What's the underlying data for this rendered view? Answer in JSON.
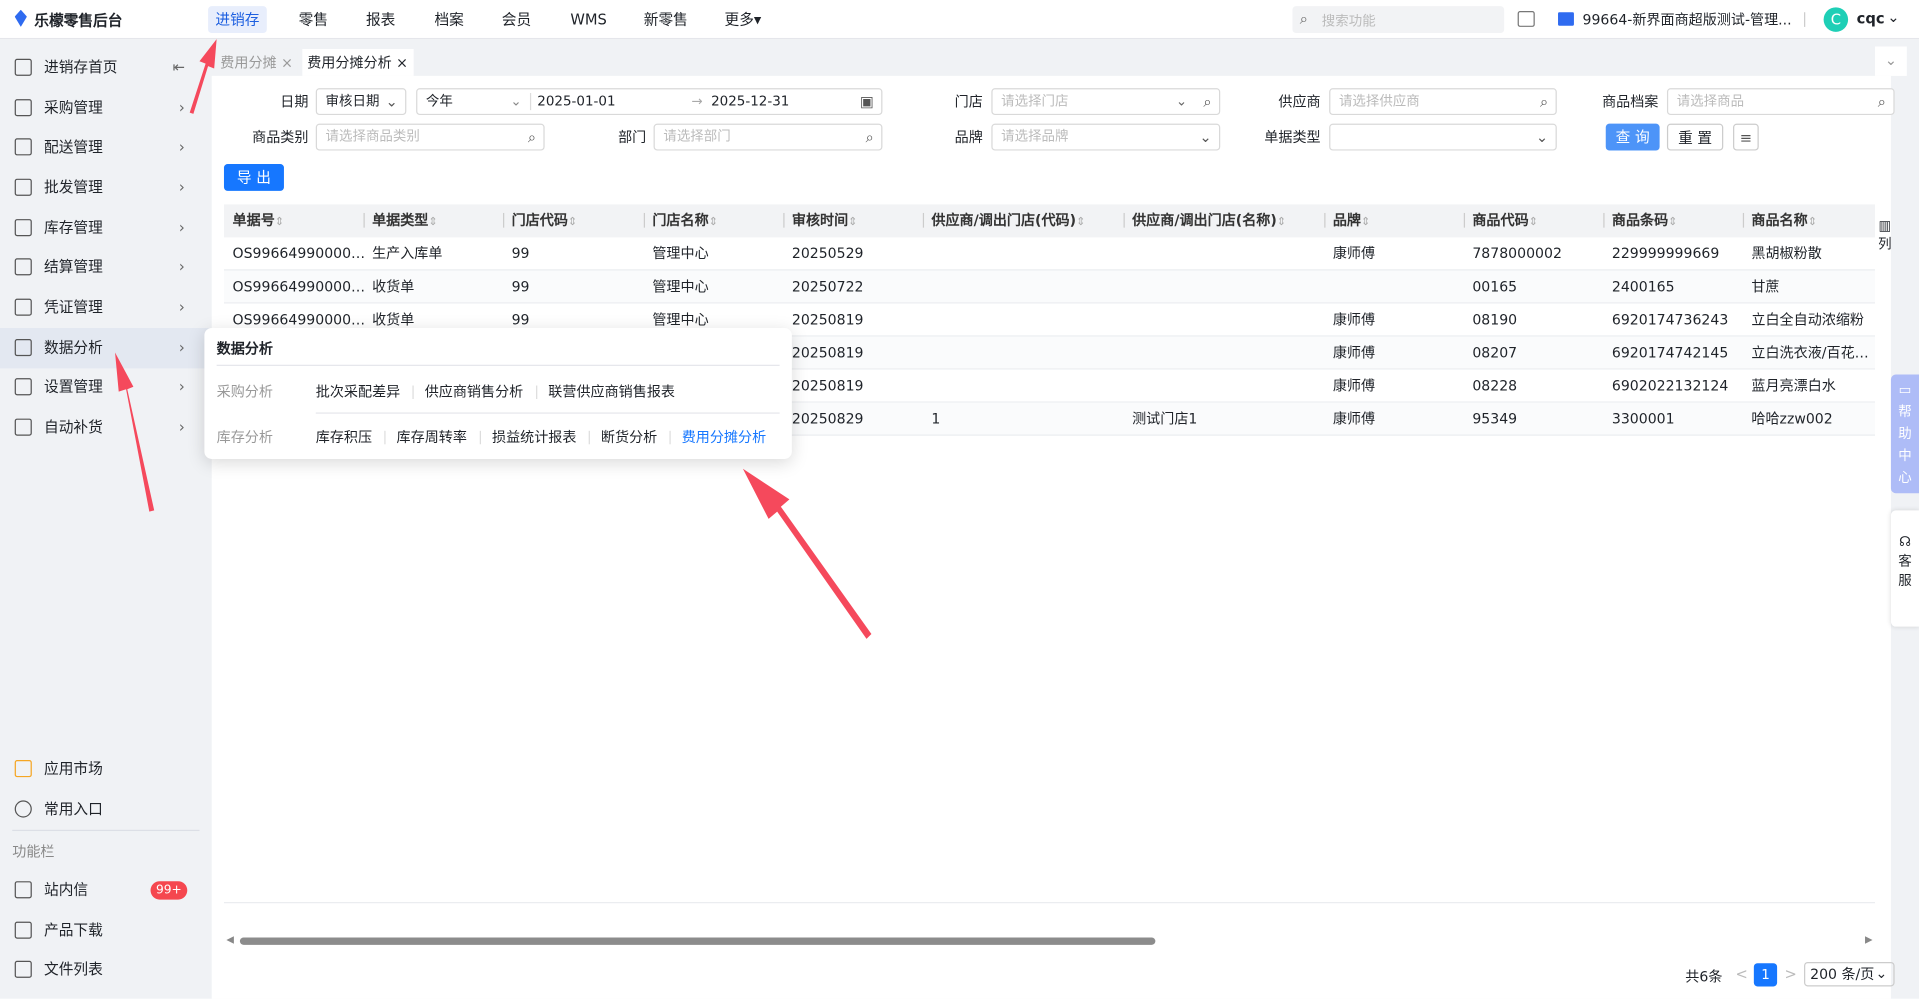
{
  "app": {
    "title": "乐檬零售后台"
  },
  "topnav": [
    {
      "label": "进销存",
      "active": true
    },
    {
      "label": "零售"
    },
    {
      "label": "报表"
    },
    {
      "label": "档案"
    },
    {
      "label": "会员"
    },
    {
      "label": "WMS"
    },
    {
      "label": "新零售"
    },
    {
      "label": "更多▾"
    }
  ],
  "header": {
    "search_placeholder": "搜索功能",
    "store": "99664-新界面商超版测试-管理...",
    "avatar_letter": "C",
    "user": "cqc"
  },
  "sidebar": {
    "items": [
      {
        "label": "进销存首页"
      },
      {
        "label": "采购管理"
      },
      {
        "label": "配送管理"
      },
      {
        "label": "批发管理"
      },
      {
        "label": "库存管理"
      },
      {
        "label": "结算管理"
      },
      {
        "label": "凭证管理"
      },
      {
        "label": "数据分析",
        "active": true
      },
      {
        "label": "设置管理"
      },
      {
        "label": "自动补货"
      }
    ],
    "bottom": [
      {
        "label": "应用市场"
      },
      {
        "label": "常用入口"
      }
    ],
    "section": "功能栏",
    "tools": [
      {
        "label": "站内信",
        "badge": "99+"
      },
      {
        "label": "产品下载"
      },
      {
        "label": "文件列表"
      }
    ]
  },
  "tabs": [
    {
      "label": "费用分摊",
      "close": "×"
    },
    {
      "label": "费用分摊分析",
      "close": "×",
      "active": true
    }
  ],
  "filters": {
    "date_label": "日期",
    "date_type": "审核日期",
    "date_preset": "今年",
    "date_start": "2025-01-01",
    "date_sep": "→",
    "date_end": "2025-12-31",
    "store_label": "门店",
    "store_placeholder": "请选择门店",
    "supplier_label": "供应商",
    "supplier_placeholder": "请选择供应商",
    "product_label": "商品档案",
    "product_placeholder": "请选择商品",
    "category_label": "商品类别",
    "category_placeholder": "请选择商品类别",
    "dept_label": "部门",
    "dept_placeholder": "请选择部门",
    "brand_label": "品牌",
    "brand_placeholder": "请选择品牌",
    "doctype_label": "单据类型",
    "doctype_value": "",
    "query": "查 询",
    "reset": "重 置"
  },
  "export": "导 出",
  "table": {
    "columns": [
      "单据号",
      "单据类型",
      "门店代码",
      "门店名称",
      "审核时间",
      "供应商/调出门店(代码)",
      "供应商/调出门店(名称)",
      "品牌",
      "商品代码",
      "商品条码",
      "商品名称"
    ],
    "col_settings": "列",
    "rows": [
      [
        "OS99664990000…",
        "生产入库单",
        "99",
        "管理中心",
        "20250529",
        "",
        "",
        "康师傅",
        "7878000002",
        "229999999669",
        "黑胡椒粉散"
      ],
      [
        "OS99664990000…",
        "收货单",
        "99",
        "管理中心",
        "20250722",
        "",
        "",
        "",
        "00165",
        "2400165",
        "甘蔗"
      ],
      [
        "OS99664990000…",
        "收货单",
        "99",
        "管理中心",
        "20250819",
        "",
        "",
        "康师傅",
        "08190",
        "6920174736243",
        "立白全自动浓缩粉"
      ],
      [
        "",
        "",
        "",
        "",
        "20250819",
        "",
        "",
        "康师傅",
        "08207",
        "6920174742145",
        "立白洗衣液/百花…"
      ],
      [
        "",
        "",
        "",
        "",
        "20250819",
        "",
        "",
        "康师傅",
        "08228",
        "6902022132124",
        "蓝月亮漂白水"
      ],
      [
        "",
        "",
        "",
        "",
        "20250829",
        "1",
        "测试门店1",
        "康师傅",
        "95349",
        "3300001",
        "哈哈zzw002"
      ]
    ]
  },
  "pagination": {
    "total": "共6条",
    "page": "1",
    "page_size": "200 条/页"
  },
  "float": {
    "help": "帮助中心",
    "service": "客服"
  },
  "menu": {
    "title": "数据分析",
    "groups": [
      {
        "label": "采购分析",
        "links": [
          "批次采配差异",
          "供应商销售分析",
          "联营供应商销售报表"
        ]
      },
      {
        "label": "库存分析",
        "links": [
          "库存积压",
          "库存周转率",
          "损益统计报表",
          "断货分析",
          "费用分摊分析"
        ]
      }
    ]
  },
  "colors": {
    "accent": "#1677ff",
    "annotation": "#f5495c",
    "badge": "#f5474f"
  }
}
